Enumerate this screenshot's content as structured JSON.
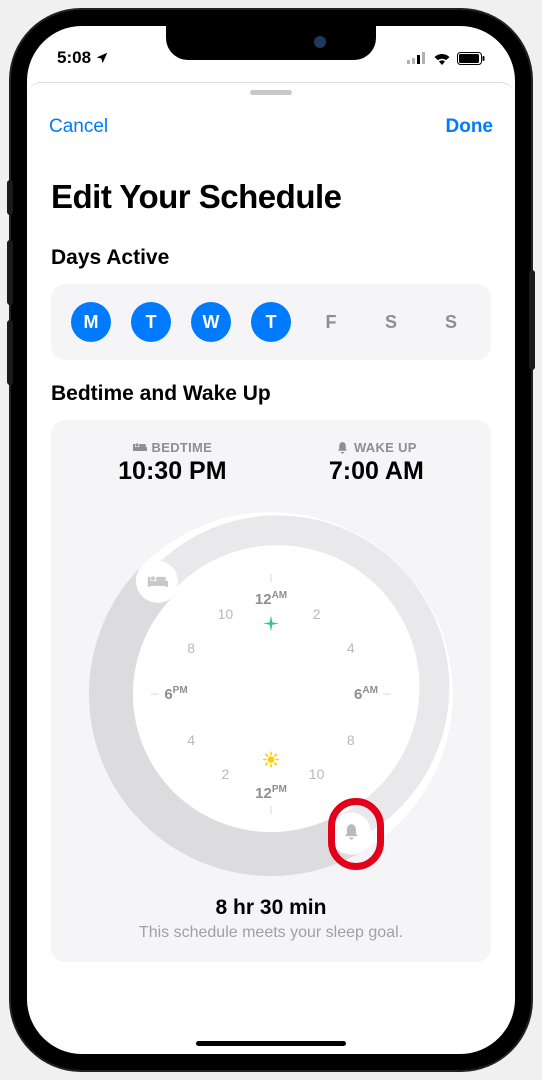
{
  "status": {
    "time": "5:08",
    "signal_bars": 3,
    "wifi": true,
    "battery_pct": 90
  },
  "nav": {
    "cancel": "Cancel",
    "done": "Done"
  },
  "title": "Edit Your Schedule",
  "days": {
    "heading": "Days Active",
    "items": [
      {
        "letter": "M",
        "active": true
      },
      {
        "letter": "T",
        "active": true
      },
      {
        "letter": "W",
        "active": true
      },
      {
        "letter": "T",
        "active": true
      },
      {
        "letter": "F",
        "active": false
      },
      {
        "letter": "S",
        "active": false
      },
      {
        "letter": "S",
        "active": false
      }
    ]
  },
  "schedule": {
    "heading": "Bedtime and Wake Up",
    "bedtime_label": "BEDTIME",
    "bedtime_value": "10:30 PM",
    "wakeup_label": "WAKE UP",
    "wakeup_value": "7:00 AM",
    "duration": "8 hr 30 min",
    "goal_text": "This schedule meets your sleep goal."
  },
  "dial": {
    "bedtime_angle_deg": 315,
    "wakeup_angle_deg": 210,
    "labels": {
      "top": "12",
      "top_suffix": "AM",
      "right": "6",
      "right_suffix": "AM",
      "bottom": "12",
      "bottom_suffix": "PM",
      "left": "6",
      "left_suffix": "PM",
      "h2": "2",
      "h4": "4",
      "h8": "8",
      "h10": "10"
    }
  }
}
